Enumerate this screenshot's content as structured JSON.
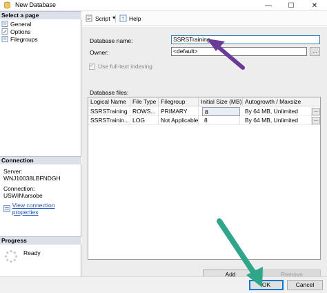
{
  "window": {
    "title": "New Database",
    "minimize_glyph": "—",
    "maximize_glyph": "☐",
    "close_glyph": "✕"
  },
  "left_pane": {
    "select_page_header": "Select a page",
    "pages": [
      {
        "label": "General",
        "icon": "page-icon"
      },
      {
        "label": "Options",
        "icon": "wrench-icon"
      },
      {
        "label": "Filegroups",
        "icon": "page-icon"
      }
    ],
    "connection_header": "Connection",
    "server_label": "Server:",
    "server_value": "WNJ10038LBFNDGH",
    "connection_label": "Connection:",
    "connection_value": "USWIN\\arsobe",
    "view_connection_link": "View connection properties",
    "progress_header": "Progress",
    "progress_status": "Ready"
  },
  "toolbar": {
    "script_label": "Script",
    "help_label": "Help"
  },
  "form": {
    "database_name_label": "Database name:",
    "database_name_value": "SSRSTraining",
    "owner_label": "Owner:",
    "owner_value": "<default>",
    "browse_glyph": "...",
    "fulltext_label": "Use full-text indexing",
    "database_files_label": "Database files:"
  },
  "files_table": {
    "columns": [
      "Logical Name",
      "File Type",
      "Filegroup",
      "Initial Size (MB)",
      "Autogrowth / Maxsize"
    ],
    "rows": [
      {
        "logical_name": "SSRSTraining",
        "file_type": "ROWS...",
        "filegroup": "PRIMARY",
        "initial_size": "8",
        "autogrowth": "By 64 MB, Unlimited"
      },
      {
        "logical_name": "SSRSTrainin...",
        "file_type": "LOG",
        "filegroup": "Not Applicable",
        "initial_size": "8",
        "autogrowth": "By 64 MB, Unlimited"
      }
    ],
    "ellipsis_glyph": "..."
  },
  "buttons": {
    "add": "Add",
    "remove": "Remove",
    "ok": "OK",
    "cancel": "Cancel"
  },
  "colors": {
    "arrow_purple": "#6a3c9a",
    "arrow_teal": "#2fa58a",
    "header_band": "#dbe0ea",
    "link_blue": "#1a4fb5"
  }
}
